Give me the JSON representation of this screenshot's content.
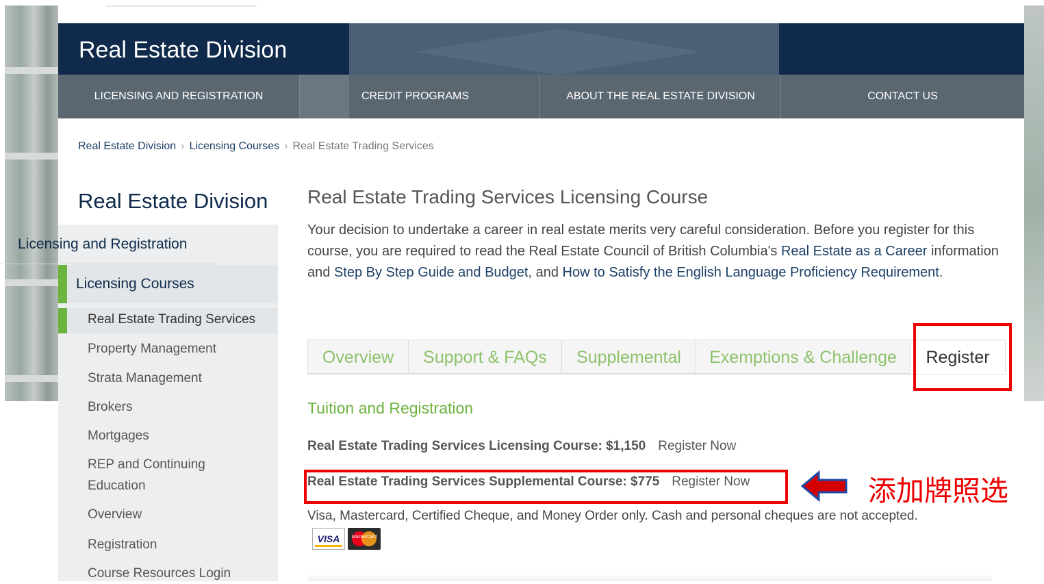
{
  "header": {
    "title": "Real Estate Division",
    "nav": [
      "LICENSING AND REGISTRATION",
      "CREDIT PROGRAMS",
      "ABOUT THE REAL ESTATE DIVISION",
      "CONTACT US"
    ]
  },
  "breadcrumb": [
    "Real Estate Division",
    "Licensing Courses",
    "Real Estate Trading Services"
  ],
  "sidebar": {
    "title": "Real Estate Division",
    "sections": [
      "Licensing and Registration",
      "Licensing Courses"
    ],
    "items": [
      "Real Estate Trading Services",
      "Property Management",
      "Strata Management",
      "Brokers",
      "Mortgages",
      "REP and Continuing",
      "Education",
      "Overview",
      "Registration",
      "Course Resources Login"
    ]
  },
  "main": {
    "heading": "Real Estate Trading Services Licensing Course",
    "intro": {
      "p1": "Your decision to undertake a career in real estate merits very careful consideration. Before you register for this course, you are required to read the Real Estate Council of British Columbia's ",
      "link1": "Real Estate as a Career",
      "p2": " information and ",
      "link2": "Step By Step Guide and Budget",
      "p3": ", and ",
      "link3": "How to Satisfy the English Language Proficiency Requirement",
      "p4": "."
    },
    "tabs": [
      "Overview",
      "Support & FAQs",
      "Supplemental",
      "Exemptions & Challenge",
      "Register"
    ],
    "active_tab": "Register",
    "section_heading": "Tuition and Registration",
    "courses": [
      {
        "name": "Real Estate Trading Services Licensing Course: $1,150",
        "action": "Register Now"
      },
      {
        "name": "Real Estate Trading Services Supplemental Course: $775",
        "action": "Register Now"
      }
    ],
    "payment_note": "Visa, Mastercard, Certified Cheque, and Money Order only. Cash and personal cheques are not accepted.",
    "cards": {
      "visa": "VISA",
      "mastercard": "MasterCard"
    }
  },
  "annotation": {
    "text": "添加牌照选",
    "color": "#ee0000"
  },
  "colors": {
    "navy": "#0f2a4a",
    "nav_gray": "#5a6670",
    "green": "#6db33f",
    "tab_green": "#8dc26b",
    "highlight_red": "#ee0000"
  }
}
